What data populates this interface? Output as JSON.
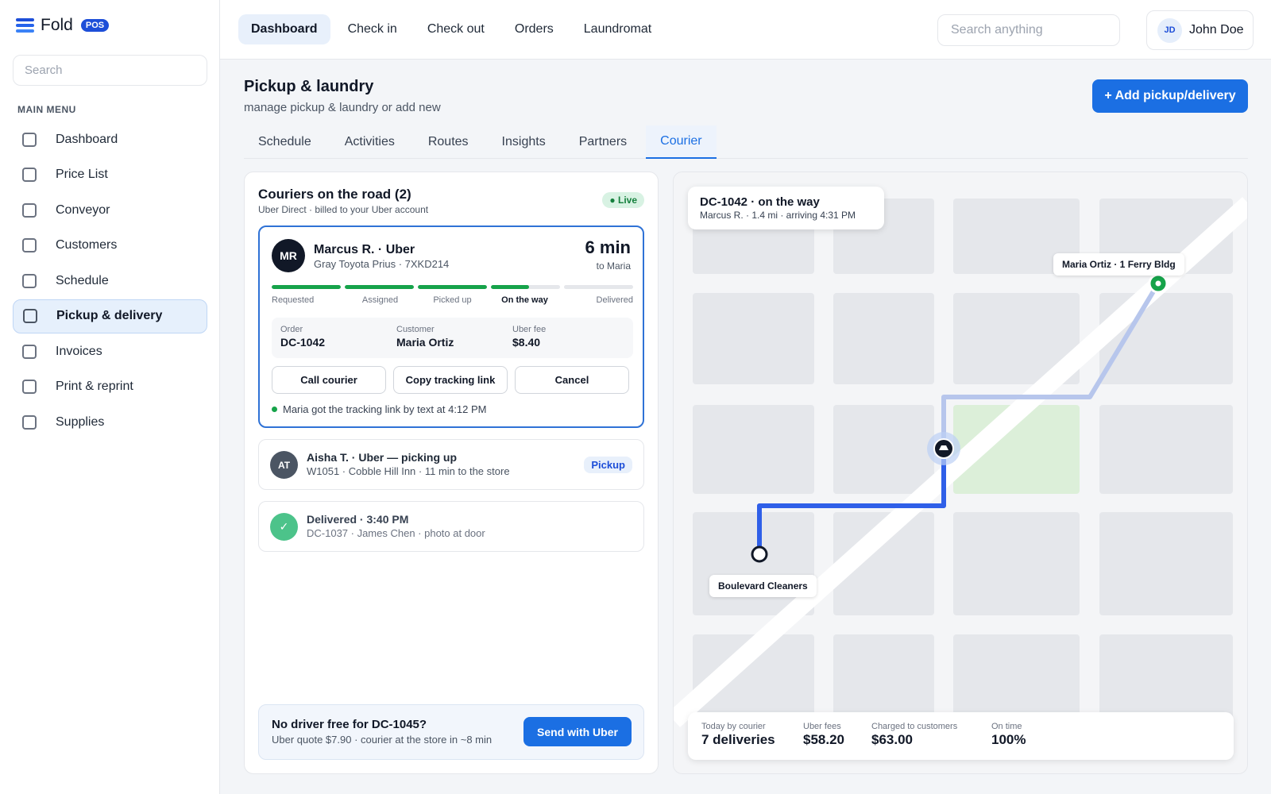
{
  "app": {
    "name": "Fold",
    "badge": "POS"
  },
  "sidebar": {
    "search_placeholder": "Search",
    "menu_label": "MAIN MENU",
    "items": [
      {
        "label": "Dashboard"
      },
      {
        "label": "Price List"
      },
      {
        "label": "Conveyor"
      },
      {
        "label": "Customers"
      },
      {
        "label": "Schedule"
      },
      {
        "label": "Pickup & delivery",
        "active": true
      },
      {
        "label": "Invoices"
      },
      {
        "label": "Print & reprint"
      },
      {
        "label": "Supplies"
      }
    ]
  },
  "topnav": {
    "items": [
      {
        "label": "Dashboard",
        "active": true
      },
      {
        "label": "Check in"
      },
      {
        "label": "Check out"
      },
      {
        "label": "Orders"
      },
      {
        "label": "Laundromat"
      }
    ],
    "search_placeholder": "Search anything",
    "user": {
      "initials": "JD",
      "name": "John Doe"
    }
  },
  "page": {
    "title": "Pickup & laundry",
    "subtitle": "manage pickup & laundry or add new",
    "add_button": "+ Add pickup/delivery",
    "tabs": [
      {
        "label": "Schedule"
      },
      {
        "label": "Activities"
      },
      {
        "label": "Routes"
      },
      {
        "label": "Insights"
      },
      {
        "label": "Partners"
      },
      {
        "label": "Courier",
        "active": true
      }
    ]
  },
  "couriers": {
    "title": "Couriers on the road (2)",
    "subtitle": "Uber Direct · billed to your Uber account",
    "live_label": "● Live",
    "active": {
      "initials": "MR",
      "name": "Marcus R. · Uber",
      "vehicle": "Gray Toyota Prius · 7XKD214",
      "eta": "6 min",
      "eta_to": "to Maria",
      "steps": [
        "Requested",
        "Assigned",
        "Picked up",
        "On the way",
        "Delivered"
      ],
      "current_step": 3,
      "step_progress": [
        1,
        1,
        1,
        0.55,
        0
      ],
      "order_label": "Order",
      "order": "DC-1042",
      "customer_label": "Customer",
      "customer": "Maria Ortiz",
      "fee_label": "Uber fee",
      "fee": "$8.40",
      "buttons": {
        "call": "Call courier",
        "copy": "Copy tracking link",
        "cancel": "Cancel"
      },
      "note": "Maria got the tracking link by text at 4:12 PM"
    },
    "others": [
      {
        "initials": "AT",
        "title": "Aisha T. · Uber — picking up",
        "subtitle": "W1051 · Cobble Hill Inn · 11 min to the store",
        "badge": "Pickup"
      },
      {
        "icon": "check-icon",
        "title": "Delivered · 3:40 PM",
        "subtitle": "DC-1037 · James Chen · photo at door"
      }
    ],
    "no_driver": {
      "title": "No driver free for DC-1045?",
      "subtitle": "Uber quote $7.90 · courier at the store in ~8 min",
      "button": "Send with Uber"
    }
  },
  "map": {
    "tooltip_title": "DC-1042 · on the way",
    "tooltip_sub": "Marcus R. · 1.4 mi · arriving 4:31 PM",
    "destination_label": "Maria Ortiz · 1 Ferry Bldg",
    "origin_label": "Boulevard Cleaners",
    "courier_icon": "car-icon",
    "colors": {
      "route": "#2f5fe8",
      "route_remaining": "#b7c6ec",
      "destination": "#16a34a",
      "park": "#dcefd9"
    },
    "stats": [
      {
        "label": "Today by courier",
        "value": "7 deliveries"
      },
      {
        "label": "Uber fees",
        "value": "$58.20"
      },
      {
        "label": "Charged to customers",
        "value": "$63.00"
      },
      {
        "label": "On time",
        "value": "100%"
      }
    ]
  }
}
